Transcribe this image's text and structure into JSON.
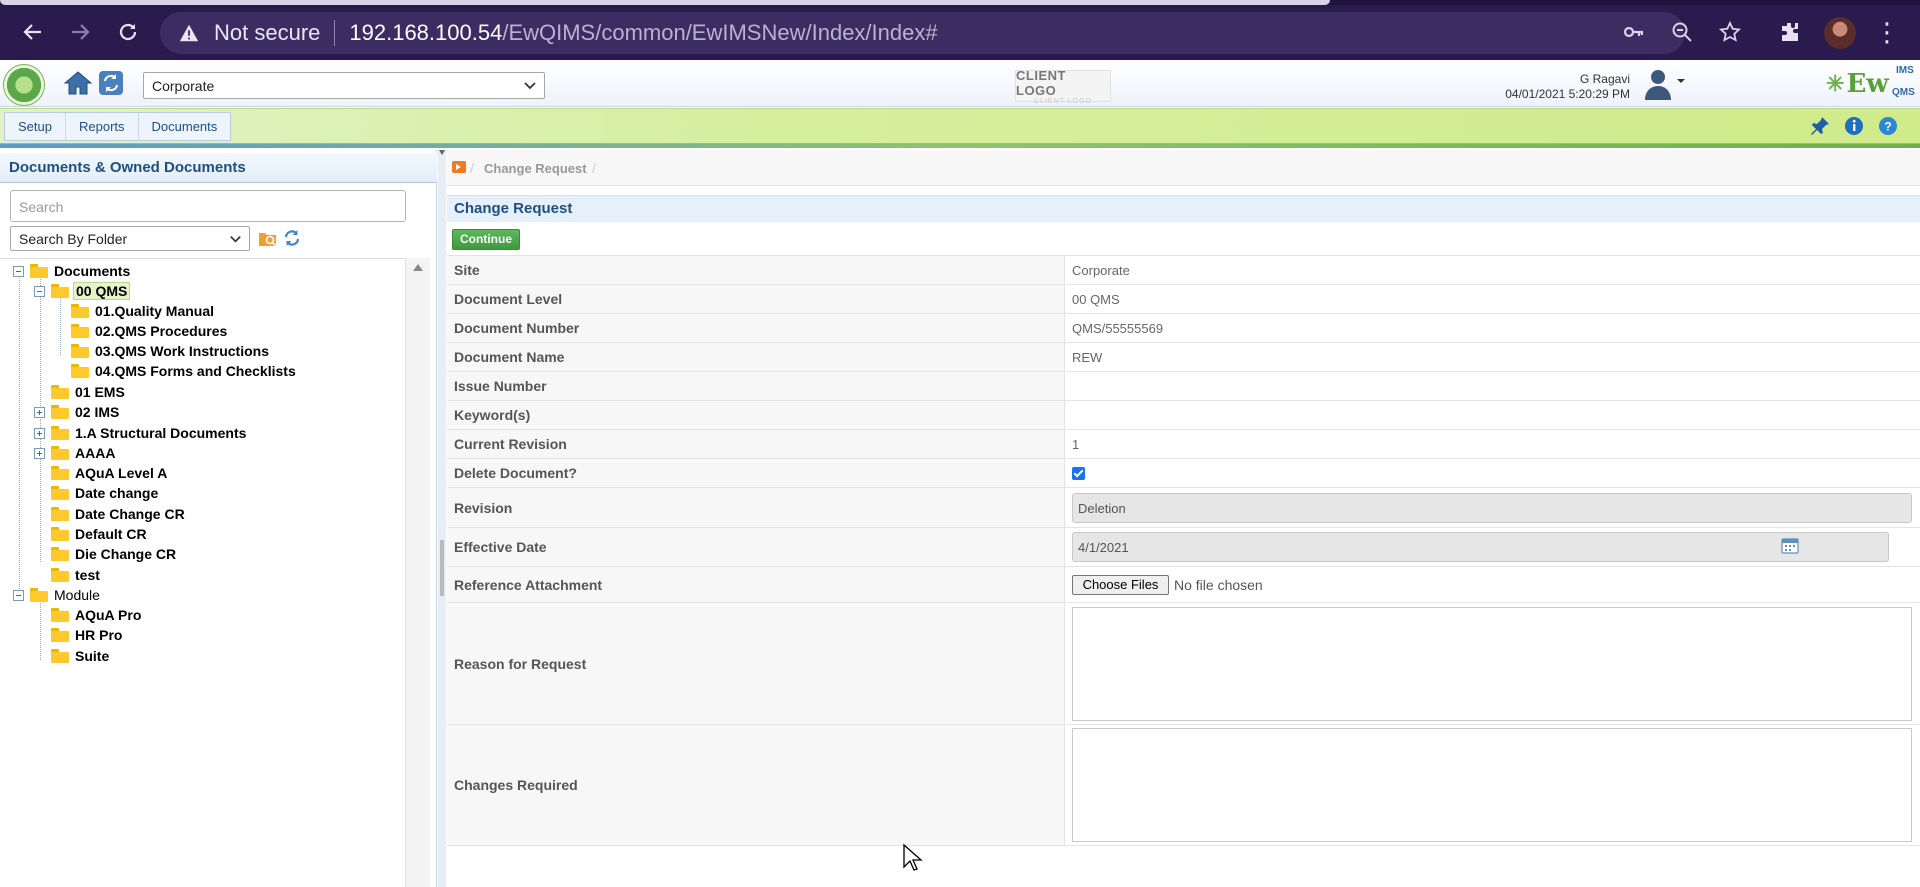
{
  "browser": {
    "security_label": "Not secure",
    "url_host": "192.168.100.54",
    "url_path": "/EwQIMS/common/EwIMSNew/Index/Index#"
  },
  "header": {
    "site_selected": "Corporate",
    "client_logo": "CLIENT LOGO",
    "client_logo_ghost": "CLIENT LOGO",
    "user_name": "G Ragavi",
    "user_datetime": "04/01/2021 5:20:29 PM",
    "product_logo": "Ew",
    "product_logo_sup": "IMS",
    "product_logo_sub": "QMS"
  },
  "menu": {
    "tabs": [
      "Setup",
      "Reports",
      "Documents"
    ]
  },
  "left_panel": {
    "title": "Documents & Owned Documents",
    "search_placeholder": "Search",
    "folder_filter": "Search By Folder",
    "tree": [
      {
        "label": "Documents",
        "level": 0,
        "toggle": "minus",
        "bold": true
      },
      {
        "label": "00 QMS",
        "level": 1,
        "toggle": "minus",
        "selected": true,
        "bold": true
      },
      {
        "label": "01.Quality Manual",
        "level": 2,
        "bold": true
      },
      {
        "label": "02.QMS Procedures",
        "level": 2,
        "bold": true
      },
      {
        "label": "03.QMS Work Instructions",
        "level": 2,
        "bold": true
      },
      {
        "label": "04.QMS Forms and Checklists",
        "level": 2,
        "bold": true
      },
      {
        "label": "01 EMS",
        "level": 1,
        "bold": true
      },
      {
        "label": "02 IMS",
        "level": 1,
        "toggle": "plus",
        "bold": true
      },
      {
        "label": "1.A Structural Documents",
        "level": 1,
        "toggle": "plus",
        "bold": true
      },
      {
        "label": "AAAA",
        "level": 1,
        "toggle": "plus",
        "bold": true
      },
      {
        "label": "AQuA Level A",
        "level": 1,
        "bold": true
      },
      {
        "label": "Date change",
        "level": 1,
        "bold": true
      },
      {
        "label": "Date Change CR",
        "level": 1,
        "bold": true
      },
      {
        "label": "Default CR",
        "level": 1,
        "bold": true
      },
      {
        "label": "Die Change CR",
        "level": 1,
        "bold": true
      },
      {
        "label": "test",
        "level": 1,
        "bold": true
      },
      {
        "label": "Module",
        "level": 0,
        "toggle": "minus",
        "bold": false
      },
      {
        "label": "AQuA Pro",
        "level": 1,
        "bold": true
      },
      {
        "label": "HR Pro",
        "level": 1,
        "bold": true
      },
      {
        "label": "Suite",
        "level": 1,
        "bold": true
      }
    ]
  },
  "main": {
    "breadcrumb": "Change Request",
    "form_title": "Change Request",
    "continue_label": "Continue",
    "fields": {
      "site": {
        "label": "Site",
        "value": "Corporate"
      },
      "document_level": {
        "label": "Document Level",
        "value": "00 QMS"
      },
      "document_number": {
        "label": "Document Number",
        "value": "QMS/55555569"
      },
      "document_name": {
        "label": "Document Name",
        "value": "REW"
      },
      "issue_number": {
        "label": "Issue Number",
        "value": ""
      },
      "keywords": {
        "label": "Keyword(s)",
        "value": ""
      },
      "current_revision": {
        "label": "Current Revision",
        "value": "1"
      },
      "delete_document": {
        "label": "Delete Document?",
        "checked": true
      },
      "revision": {
        "label": "Revision",
        "value": "Deletion"
      },
      "effective_date": {
        "label": "Effective Date",
        "value": "4/1/2021"
      },
      "reference_attachment": {
        "label": "Reference Attachment",
        "button": "Choose Files",
        "status": "No file chosen"
      },
      "reason_for_request": {
        "label": "Reason for Request",
        "value": ""
      },
      "changes_required": {
        "label": "Changes Required",
        "value": ""
      }
    }
  },
  "colors": {
    "browser_bg": "#2a1b4f",
    "menu_green": "#d6ef9e",
    "title_blue": "#1f4f80",
    "continue_green": "#4cae4c",
    "folder_yellow": "#ffc92e"
  },
  "icons": [
    "back-arrow-icon",
    "forward-arrow-icon",
    "reload-icon",
    "warning-icon",
    "key-icon",
    "zoom-out-icon",
    "star-icon",
    "extensions-icon",
    "home-icon",
    "refresh-icon",
    "pin-icon",
    "info-icon",
    "help-icon",
    "folder-icon",
    "calendar-icon",
    "user-avatar-icon"
  ]
}
